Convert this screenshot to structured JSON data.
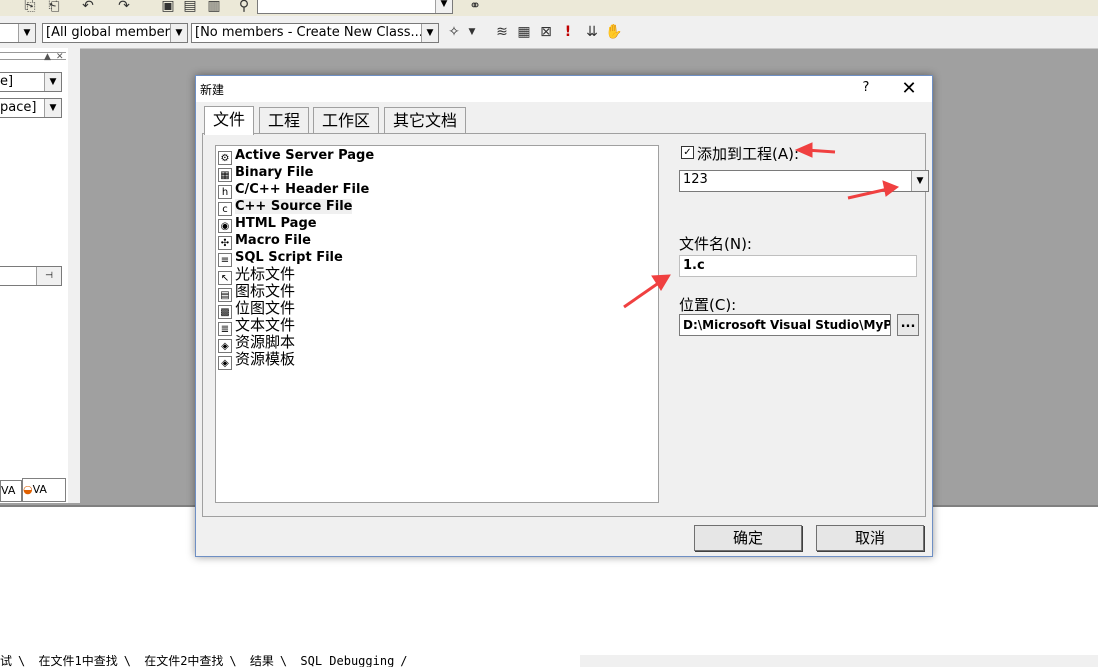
{
  "ide": {
    "class_filter": "[All global members",
    "member_filter": "[No members - Create New Class...]",
    "left_combo1": "e]",
    "left_combo2": "pace]",
    "left_tab1": "VA",
    "left_tab2": "VA",
    "bottom_tabs": [
      "试",
      "在文件1中查找",
      "在文件2中查找",
      "结果",
      "SQL Debugging"
    ]
  },
  "dialog": {
    "title": "新建",
    "help": "?",
    "close": "✕",
    "tabs": [
      "文件",
      "工程",
      "工作区",
      "其它文档"
    ],
    "files": [
      {
        "label": "Active Server Page",
        "icon": "asp-icon",
        "glyph": "⚙"
      },
      {
        "label": "Binary File",
        "icon": "binary-file-icon",
        "glyph": "▦"
      },
      {
        "label": "C/C++ Header File",
        "icon": "header-file-icon",
        "glyph": "h"
      },
      {
        "label": "C++ Source File",
        "icon": "source-file-icon",
        "glyph": "c"
      },
      {
        "label": "HTML Page",
        "icon": "html-page-icon",
        "glyph": "◉"
      },
      {
        "label": "Macro File",
        "icon": "macro-file-icon",
        "glyph": "✣"
      },
      {
        "label": "SQL Script File",
        "icon": "sql-file-icon",
        "glyph": "≡"
      },
      {
        "label": "光标文件",
        "icon": "cursor-file-icon",
        "glyph": "↖"
      },
      {
        "label": "图标文件",
        "icon": "icon-file-icon",
        "glyph": "▤"
      },
      {
        "label": "位图文件",
        "icon": "bitmap-file-icon",
        "glyph": "▩"
      },
      {
        "label": "文本文件",
        "icon": "text-file-icon",
        "glyph": "≣"
      },
      {
        "label": "资源脚本",
        "icon": "resource-script-icon",
        "glyph": "◈"
      },
      {
        "label": "资源模板",
        "icon": "resource-template-icon",
        "glyph": "◈"
      }
    ],
    "add_to_project": {
      "checked": "✓",
      "label": "添加到工程(A):"
    },
    "project": "123",
    "filename_label": "文件名(N):",
    "filename": "1.c",
    "location_label": "位置(C):",
    "location": "D:\\Microsoft Visual Studio\\MyPro",
    "browse": "...",
    "ok": "确定",
    "cancel": "取消"
  },
  "colors": {
    "annotation_arrow": "#f04040",
    "dialog_border": "#6e8fc4"
  }
}
